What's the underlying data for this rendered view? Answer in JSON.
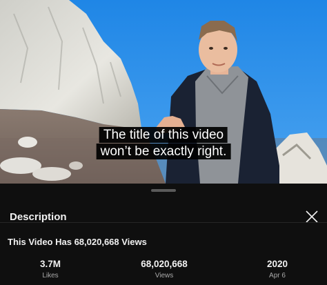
{
  "video": {
    "caption_line1": "The title of this video",
    "caption_line2": "won’t be exactly right."
  },
  "description_panel": {
    "title": "Description",
    "close_icon": "close-icon",
    "video_title": "This Video Has 68,020,668 Views",
    "stats": [
      {
        "value": "3.7M",
        "label": "Likes"
      },
      {
        "value": "68,020,668",
        "label": "Views"
      },
      {
        "value": "2020",
        "label": "Apr 6"
      }
    ]
  },
  "colors": {
    "sheet_background": "#0f0f0f",
    "sky": "#2f8de0",
    "secondary_text": "#aaaaaa"
  }
}
